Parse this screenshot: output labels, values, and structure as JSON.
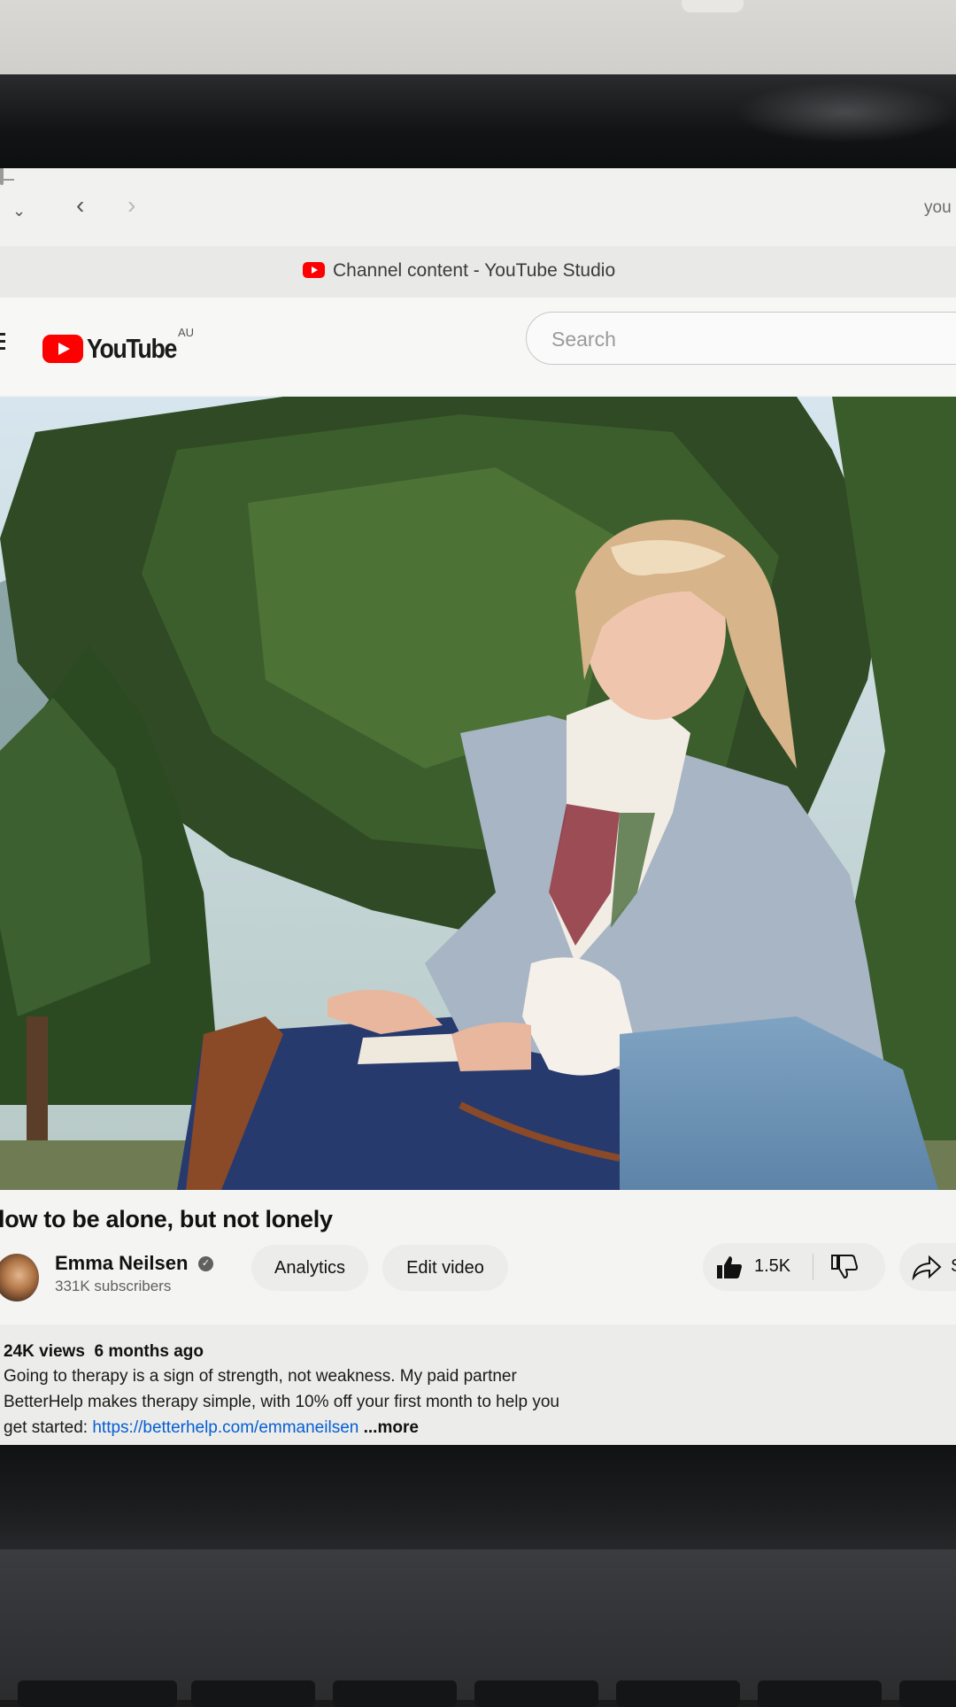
{
  "browser": {
    "url_partial": "you",
    "tab_title": "Channel content - YouTube Studio",
    "icons": {
      "dropdown": "chevron-down-icon",
      "back": "chevron-left-icon",
      "forward": "chevron-right-icon",
      "reader": "reader-icon"
    }
  },
  "masthead": {
    "logo_text": "YouTube",
    "region": "AU",
    "search_placeholder": "Search"
  },
  "video": {
    "title": "low to be alone, but not lonely",
    "channel_name": "Emma Neilsen",
    "subscribers": "331K subscribers",
    "analytics_label": "Analytics",
    "edit_label": "Edit video",
    "like_count": "1.5K",
    "share_label": "S"
  },
  "description": {
    "views": "24K views",
    "age": "6 months ago",
    "line1": "Going to therapy is a sign of strength, not weakness. My paid partner",
    "line2": "BetterHelp makes therapy simple, with 10% off your first month to help you",
    "line3_prefix": "get started: ",
    "link": "https://betterhelp.com/emmaneilsen",
    "more": "...more"
  },
  "colors": {
    "brand_red": "#ff0000",
    "link_blue": "#065fd4",
    "pill_bg": "#ececea"
  }
}
